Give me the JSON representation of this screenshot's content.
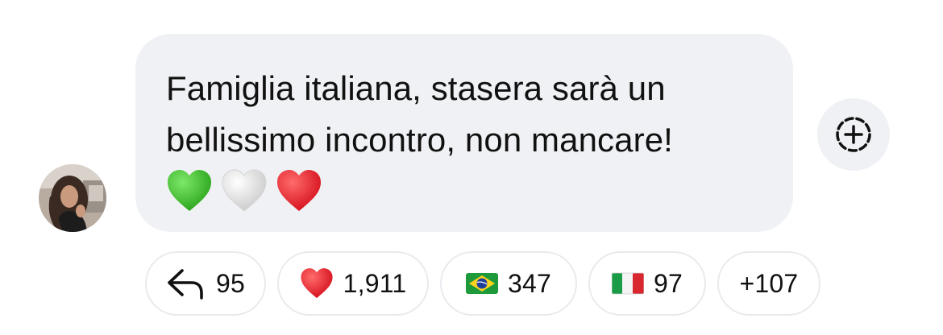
{
  "message": {
    "author_avatar_alt": "profile photo",
    "lines": [
      "Famiglia italiana, stasera sarà un",
      "bellissimo incontro, non mancare!"
    ],
    "emoji": [
      "green-heart",
      "white-heart",
      "red-heart"
    ]
  },
  "reactions": [
    {
      "icon": "reply-arrow-icon",
      "count": "95"
    },
    {
      "icon": "red-heart-emoji",
      "count": "1,911"
    },
    {
      "icon": "brazil-flag-emoji",
      "count": "347"
    },
    {
      "icon": "italy-flag-emoji",
      "count": "97"
    },
    {
      "icon": "",
      "count": "+107"
    }
  ],
  "add_reaction": {
    "icon": "add-reaction-icon"
  },
  "colors": {
    "bubble": "#f0f1f4",
    "text": "#111111",
    "chip_border": "#e9eaee",
    "heart_red": "#e8202b",
    "heart_green": "#3fbf2d"
  }
}
